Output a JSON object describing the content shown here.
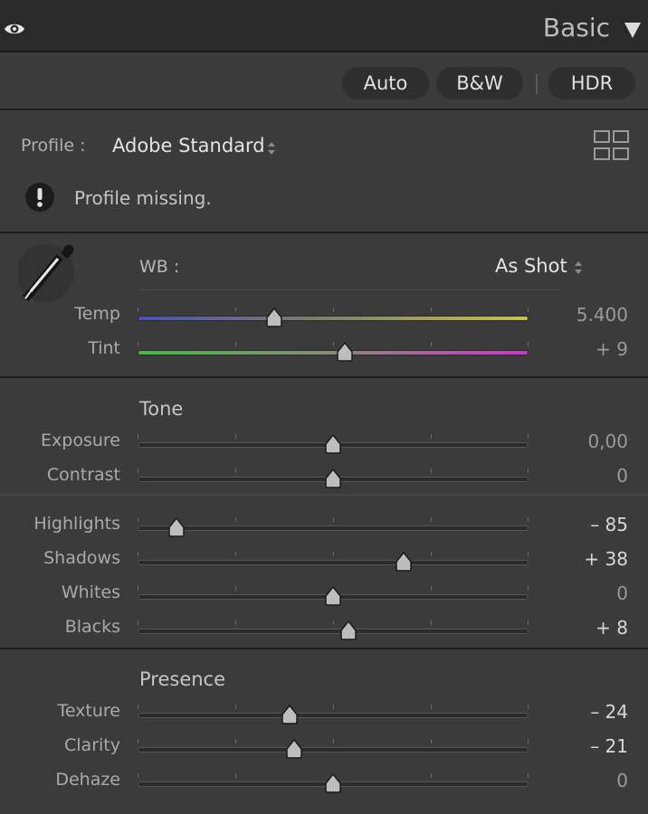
{
  "header": {
    "title": "Basic",
    "visibility_icon": "eye-icon",
    "collapse_icon": "triangle-down-icon"
  },
  "auto_buttons": {
    "auto": "Auto",
    "bw": "B&W",
    "hdr": "HDR"
  },
  "profile": {
    "label": "Profile :",
    "value": "Adobe Standard",
    "browse_icon": "grid-icon",
    "warning_icon": "exclamation-icon",
    "warning": "Profile missing."
  },
  "white_balance": {
    "label": "WB :",
    "value": "As Shot",
    "picker_icon": "eyedropper-icon"
  },
  "wb_sliders": [
    {
      "key": "temp",
      "label": "Temp",
      "value": "5.400",
      "position": 0.35
    },
    {
      "key": "tint",
      "label": "Tint",
      "value": "+ 9",
      "position": 0.53
    }
  ],
  "tone": {
    "heading": "Tone",
    "sliders": [
      {
        "key": "exposure",
        "label": "Exposure",
        "value": "0,00",
        "position": 0.5
      },
      {
        "key": "contrast",
        "label": "Contrast",
        "value": "0",
        "position": 0.5
      },
      {
        "key": "highlights",
        "label": "Highlights",
        "value": "– 85",
        "position": 0.1
      },
      {
        "key": "shadows",
        "label": "Shadows",
        "value": "+ 38",
        "position": 0.68
      },
      {
        "key": "whites",
        "label": "Whites",
        "value": "0",
        "position": 0.5
      },
      {
        "key": "blacks",
        "label": "Blacks",
        "value": "+ 8",
        "position": 0.54
      }
    ]
  },
  "presence": {
    "heading": "Presence",
    "sliders": [
      {
        "key": "texture",
        "label": "Texture",
        "value": "– 24",
        "position": 0.39
      },
      {
        "key": "clarity",
        "label": "Clarity",
        "value": "– 21",
        "position": 0.4
      },
      {
        "key": "dehaze",
        "label": "Dehaze",
        "value": "0",
        "position": 0.5
      }
    ]
  }
}
